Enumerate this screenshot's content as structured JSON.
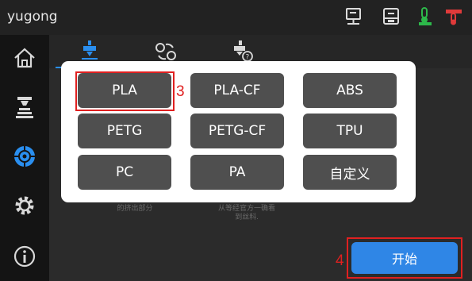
{
  "app": {
    "title": "yugong"
  },
  "topbar": {
    "icons": [
      "network-icon",
      "printer-icon",
      "nozzle-temp-icon",
      "bed-temp-icon"
    ],
    "accent_green": "#2db84a",
    "accent_red": "#e03a3a"
  },
  "sidebar": {
    "items": [
      "home-icon",
      "print-icon",
      "filament-icon",
      "settings-icon",
      "info-icon"
    ],
    "active": "filament-icon",
    "active_color": "#2a8ff0"
  },
  "tabs": {
    "items": [
      "load-filament-icon",
      "change-filament-icon",
      "filament-help-icon"
    ],
    "active_color": "#2a8ff0"
  },
  "background_text": {
    "left_line": "的挤出部分",
    "right_line1": "从等经官方一确看",
    "right_line2": "到丝料."
  },
  "dialog": {
    "materials": [
      "PLA",
      "PLA-CF",
      "ABS",
      "PETG",
      "PETG-CF",
      "TPU",
      "PC",
      "PA",
      "自定义"
    ]
  },
  "annotations": {
    "step3": "3",
    "step4": "4",
    "highlight_color": "#e02020"
  },
  "start_button": {
    "label": "开始",
    "color": "#2f86e6"
  }
}
